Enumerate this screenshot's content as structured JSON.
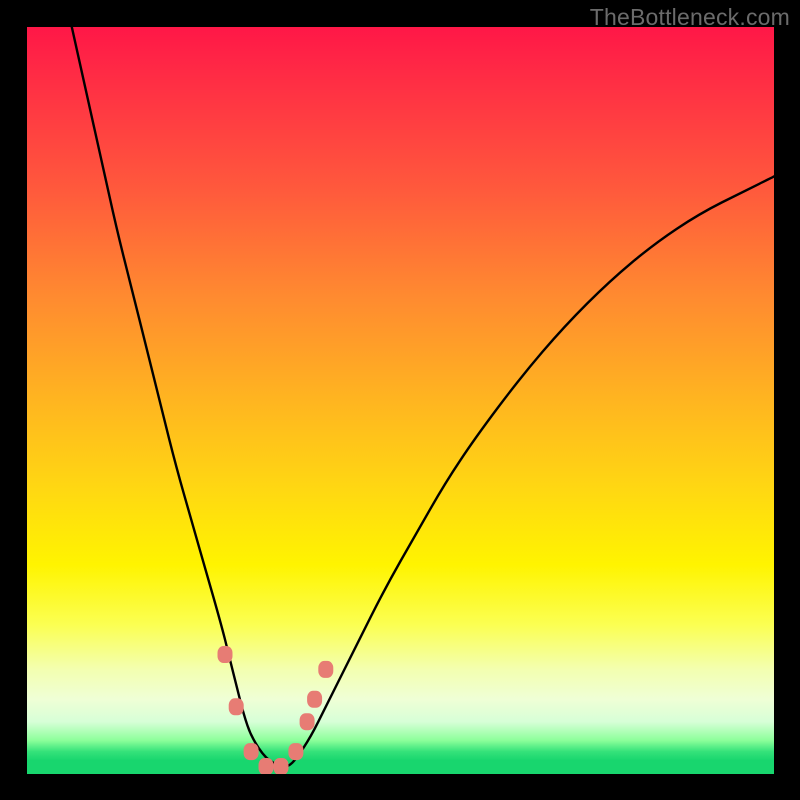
{
  "watermark": "TheBottleneck.com",
  "chart_data": {
    "type": "line",
    "title": "",
    "xlabel": "",
    "ylabel": "",
    "xlim": [
      0,
      100
    ],
    "ylim": [
      0,
      100
    ],
    "grid": false,
    "legend": false,
    "note": "Axes are unlabeled in the image. x and y are normalized 0–100 across the plot area; curve values estimated from pixel positions.",
    "series": [
      {
        "name": "bottleneck-curve",
        "color": "#000000",
        "x": [
          6,
          8,
          10,
          12,
          14,
          16,
          18,
          20,
          22,
          24,
          26,
          27,
          28,
          29,
          30,
          32,
          34,
          35,
          36,
          38,
          40,
          44,
          48,
          52,
          56,
          60,
          66,
          72,
          78,
          84,
          90,
          96,
          100
        ],
        "y": [
          100,
          91,
          82,
          73,
          65,
          57,
          49,
          41,
          34,
          27,
          20,
          16,
          12,
          8,
          5,
          2,
          1,
          1,
          2,
          5,
          9,
          17,
          25,
          32,
          39,
          45,
          53,
          60,
          66,
          71,
          75,
          78,
          80
        ]
      }
    ],
    "markers": [
      {
        "name": "highlight-points",
        "color": "#e77c74",
        "shape": "rounded",
        "points": [
          {
            "x": 26.5,
            "y": 16
          },
          {
            "x": 28.0,
            "y": 9
          },
          {
            "x": 30.0,
            "y": 3
          },
          {
            "x": 32.0,
            "y": 1
          },
          {
            "x": 34.0,
            "y": 1
          },
          {
            "x": 36.0,
            "y": 3
          },
          {
            "x": 37.5,
            "y": 7
          },
          {
            "x": 38.5,
            "y": 10
          },
          {
            "x": 40.0,
            "y": 14
          }
        ]
      }
    ]
  }
}
